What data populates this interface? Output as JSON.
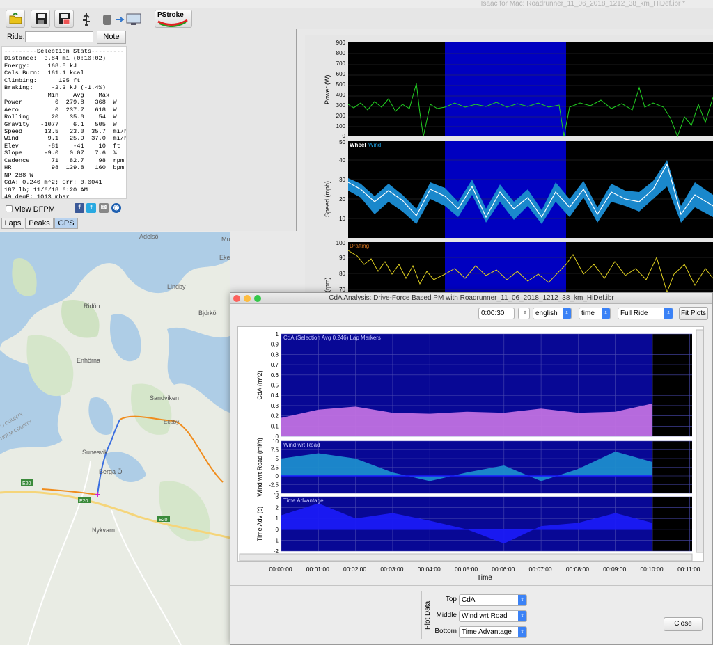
{
  "window": {
    "title": "Isaac for Mac:  Roadrunner_11_06_2018_1212_38_km_HiDef.ibr *"
  },
  "toolbar": {
    "icons": [
      "open-folder-icon",
      "save-icon",
      "save-as-icon",
      "usb-icon",
      "device-to-computer-icon",
      "pstroke-logo"
    ],
    "pstroke_label": "PStroke"
  },
  "ride": {
    "label": "Ride:",
    "value": "",
    "note_button": "Note"
  },
  "stats": {
    "text": "---------Selection Stats---------\nDistance:  3.84 mi (0:10:02)\nEnergy:     168.5 kJ\nCals Burn:  161.1 kcal\nClimbing:      195 ft\nBraking:     -2.3 kJ (-1.4%)\n            Min    Avg    Max\nPower         0  279.8   368  W\nAero          0  237.7   618  W\nRolling      20   35.0    54  W\nGravity   -1077    6.1   505  W\nSpeed      13.5   23.0  35.7  mi/h\nWind        9.1   25.9  37.0  mi/h\nElev        -81    -41    10  ft\nSlope      -9.0   0.07   7.6  %\nCadence      71   82.7    98  rpm\nHR           98  139.8   160  bpm\nNP 288 W\nCdA: 0.240 m^2; Crr: 0.0041\n187 lb; 11/6/18 6:20 AM\n49 degF; 1013 mbar"
  },
  "dfpm": {
    "label": "View DFPM"
  },
  "share": [
    "f",
    "t",
    "✉",
    "◉"
  ],
  "tabs": [
    {
      "label": "Laps"
    },
    {
      "label": "Peaks"
    },
    {
      "label": "GPS"
    }
  ],
  "map": {
    "places": [
      {
        "name": "Adelsö"
      },
      {
        "name": "Munsö"
      },
      {
        "name": "Ekeby"
      },
      {
        "name": "Lindby"
      },
      {
        "name": "Ridön"
      },
      {
        "name": "Björkö"
      },
      {
        "name": "Enhörna"
      },
      {
        "name": "Sandviken"
      },
      {
        "name": "Ekeby"
      },
      {
        "name": "Sunesvik"
      },
      {
        "name": "Berga Ö"
      },
      {
        "name": "Nykvarn"
      },
      {
        "name": "E20"
      },
      {
        "name": "E20"
      },
      {
        "name": "E20"
      },
      {
        "name": "O COUNTY"
      },
      {
        "name": "HOLM COUNTY"
      }
    ]
  },
  "top_plots": {
    "power": {
      "ylabel": "Power (W)",
      "ticks": [
        "900",
        "800",
        "700",
        "600",
        "500",
        "400",
        "300",
        "200",
        "100",
        "0"
      ]
    },
    "speed": {
      "ylabel": "Speed (mph)",
      "legend_wheel": "Wheel",
      "legend_wind": "Wind",
      "ticks": [
        "50",
        "40",
        "30",
        "20",
        "10"
      ]
    },
    "cadence": {
      "ylabel": "(rpm)",
      "legend": "Drafting",
      "ticks": [
        "100",
        "90",
        "80",
        "70"
      ]
    }
  },
  "dialog": {
    "title": "CdA Analysis:  Drive-Force Based PM with Roadrunner_11_06_2018_1212_38_km_HiDef.ibr",
    "time_value": "0:00:30",
    "units": "english",
    "xaxis_mode": "time",
    "range": "Full Ride",
    "fit_button": "Fit Plots",
    "close_button": "Close",
    "plot_data_label": "Plot Data",
    "top_label": "Top",
    "top_value": "CdA",
    "middle_label": "Middle",
    "middle_value": "Wind wrt Road",
    "bottom_label": "Bottom",
    "bottom_value": "Time Advantage"
  },
  "chart_data": [
    {
      "type": "area",
      "title": "CdA (Selection Avg 0.246) Lap Markers",
      "xlabel": "Time",
      "ylabel": "CdA (m^2)",
      "ylim": [
        0,
        1
      ],
      "yticks": [
        "1",
        "0.9",
        "0.8",
        "0.7",
        "0.6",
        "0.5",
        "0.4",
        "0.3",
        "0.2",
        "0.1",
        "0"
      ],
      "x": [
        "00:00:00",
        "00:01:00",
        "00:02:00",
        "00:03:00",
        "00:04:00",
        "00:05:00",
        "00:06:00",
        "00:07:00",
        "00:08:00",
        "00:09:00",
        "00:10:00"
      ],
      "values": [
        0.18,
        0.26,
        0.29,
        0.23,
        0.22,
        0.24,
        0.23,
        0.27,
        0.23,
        0.24,
        0.32
      ]
    },
    {
      "type": "area",
      "title": "Wind wrt Road",
      "ylabel": "Wind wrt Road (mi/h)",
      "ylim": [
        -5,
        10
      ],
      "yticks": [
        "10",
        "7.5",
        "5",
        "2.5",
        "0",
        "-2.5",
        "-5"
      ],
      "x": [
        "00:00:00",
        "00:01:00",
        "00:02:00",
        "00:03:00",
        "00:04:00",
        "00:05:00",
        "00:06:00",
        "00:07:00",
        "00:08:00",
        "00:09:00",
        "00:10:00"
      ],
      "values": [
        5,
        6.5,
        5,
        1,
        -1.5,
        1,
        3,
        -1.5,
        2,
        7,
        4
      ]
    },
    {
      "type": "area",
      "title": "Time Advantage",
      "ylabel": "Time Adv (s)",
      "ylim": [
        -2,
        3
      ],
      "yticks": [
        "3",
        "2",
        "1",
        "0",
        "-1",
        "-2"
      ],
      "x": [
        "00:00:00",
        "00:01:00",
        "00:02:00",
        "00:03:00",
        "00:04:00",
        "00:05:00",
        "00:06:00",
        "00:07:00",
        "00:08:00",
        "00:09:00",
        "00:10:00"
      ],
      "values": [
        1.3,
        2.4,
        1.0,
        1.5,
        0.8,
        0.0,
        -1.3,
        0.3,
        0.6,
        1.5,
        0.6
      ]
    }
  ],
  "xaxis_ticks": [
    "00:00:00",
    "00:01:00",
    "00:02:00",
    "00:03:00",
    "00:04:00",
    "00:05:00",
    "00:06:00",
    "00:07:00",
    "00:08:00",
    "00:09:00",
    "00:10:00",
    "00:11:00"
  ],
  "xaxis_label": "Time",
  "colors": {
    "plot_bg": "#080895",
    "selection": "#1818d8",
    "cda": "#c070e0",
    "wind": "#1c8ccc",
    "timeadv": "#1a1af5",
    "power": "#22d022",
    "speed": "#20a0e0",
    "cadence": "#e0d020"
  }
}
